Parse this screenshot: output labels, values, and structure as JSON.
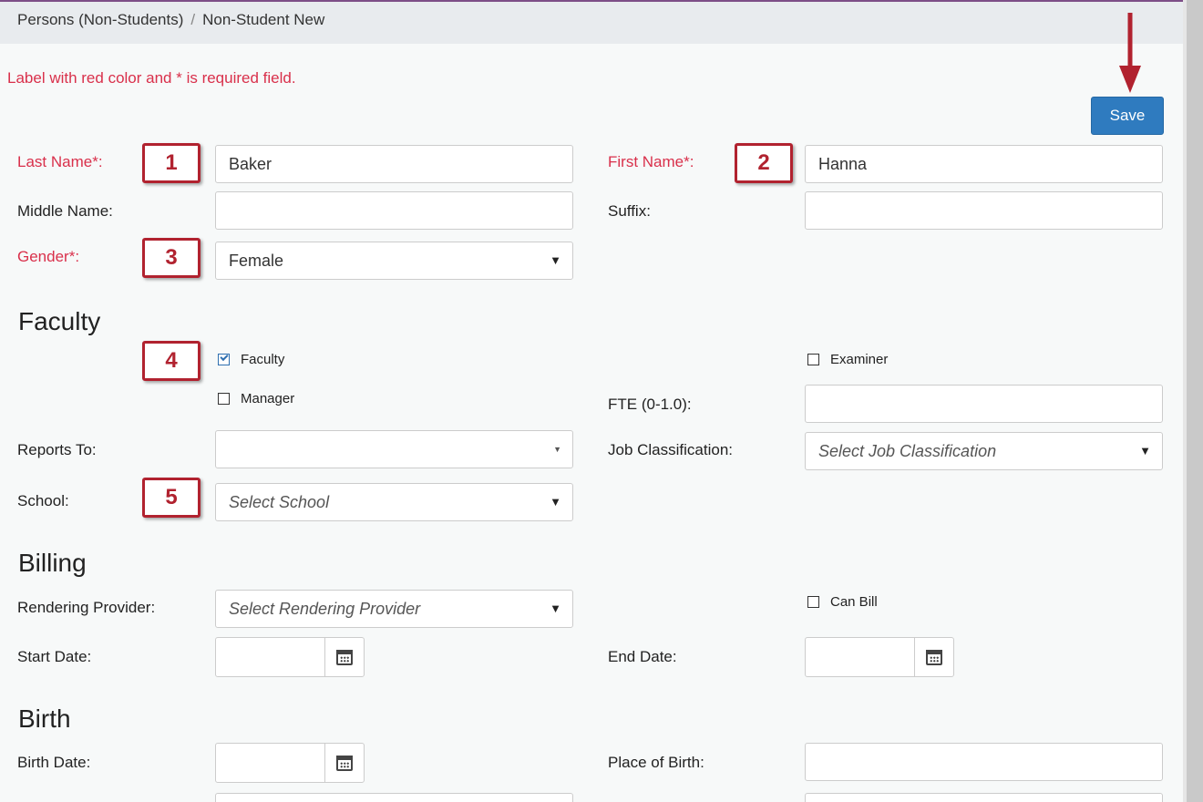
{
  "breadcrumb": {
    "parent": "Persons (Non-Students)",
    "separator": "/",
    "current": "Non-Student New"
  },
  "required_note": "Label with red color and * is required field.",
  "save_label": "Save",
  "badges": [
    "1",
    "2",
    "3",
    "4",
    "5"
  ],
  "labels": {
    "last_name": "Last Name*:",
    "first_name": "First Name*:",
    "middle_name": "Middle Name:",
    "suffix": "Suffix:",
    "gender": "Gender*:",
    "fte": "FTE (0-1.0):",
    "reports_to": "Reports To:",
    "job_classification": "Job Classification:",
    "school": "School:",
    "rendering_provider": "Rendering Provider:",
    "start_date": "Start Date:",
    "end_date": "End Date:",
    "birth_date": "Birth Date:",
    "place_of_birth": "Place of Birth:"
  },
  "values": {
    "last_name": "Baker",
    "first_name": "Hanna",
    "middle_name": "",
    "suffix": "",
    "gender": "Female",
    "fte": "",
    "reports_to": ""
  },
  "placeholders": {
    "job_classification": "Select Job Classification",
    "school": "Select School",
    "rendering_provider": "Select Rendering Provider"
  },
  "sections": {
    "faculty": "Faculty",
    "billing": "Billing",
    "birth": "Birth"
  },
  "checkboxes": {
    "faculty": {
      "label": "Faculty",
      "checked": true
    },
    "examiner": {
      "label": "Examiner",
      "checked": false
    },
    "manager": {
      "label": "Manager",
      "checked": false
    },
    "can_bill": {
      "label": "Can Bill",
      "checked": false
    }
  },
  "colors": {
    "required": "#d9304b",
    "primary": "#2f7bbf",
    "badge": "#b1222f",
    "header_accent": "#7d4e87"
  }
}
